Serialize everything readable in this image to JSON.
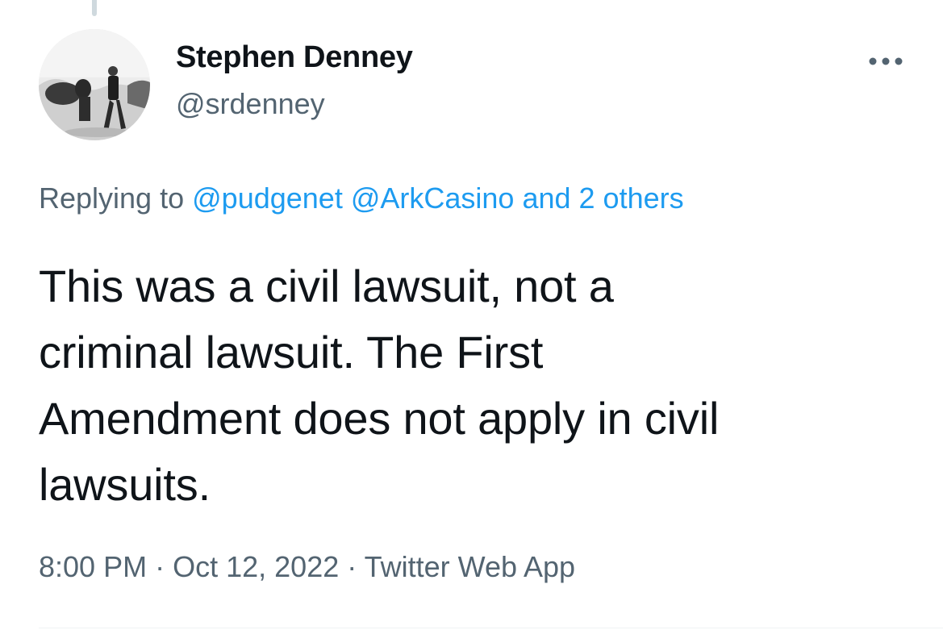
{
  "author": {
    "display_name": "Stephen Denney",
    "handle": "@srdenney"
  },
  "more_icon": "more-horizontal-icon",
  "reply": {
    "prefix": "Replying to",
    "mentions": [
      "@pudgenet",
      "@ArkCasino"
    ],
    "others": "and 2 others"
  },
  "tweet": {
    "text": "This was a civil lawsuit, not a\ncriminal lawsuit. The First\nAmendment does not apply in civil\nlawsuits."
  },
  "meta": {
    "time": "8:00 PM",
    "separator": "·",
    "date": "Oct 12, 2022",
    "source": "Twitter Web App"
  },
  "colors": {
    "text": "#0f1419",
    "secondary": "#536471",
    "link": "#1d9bf0"
  }
}
